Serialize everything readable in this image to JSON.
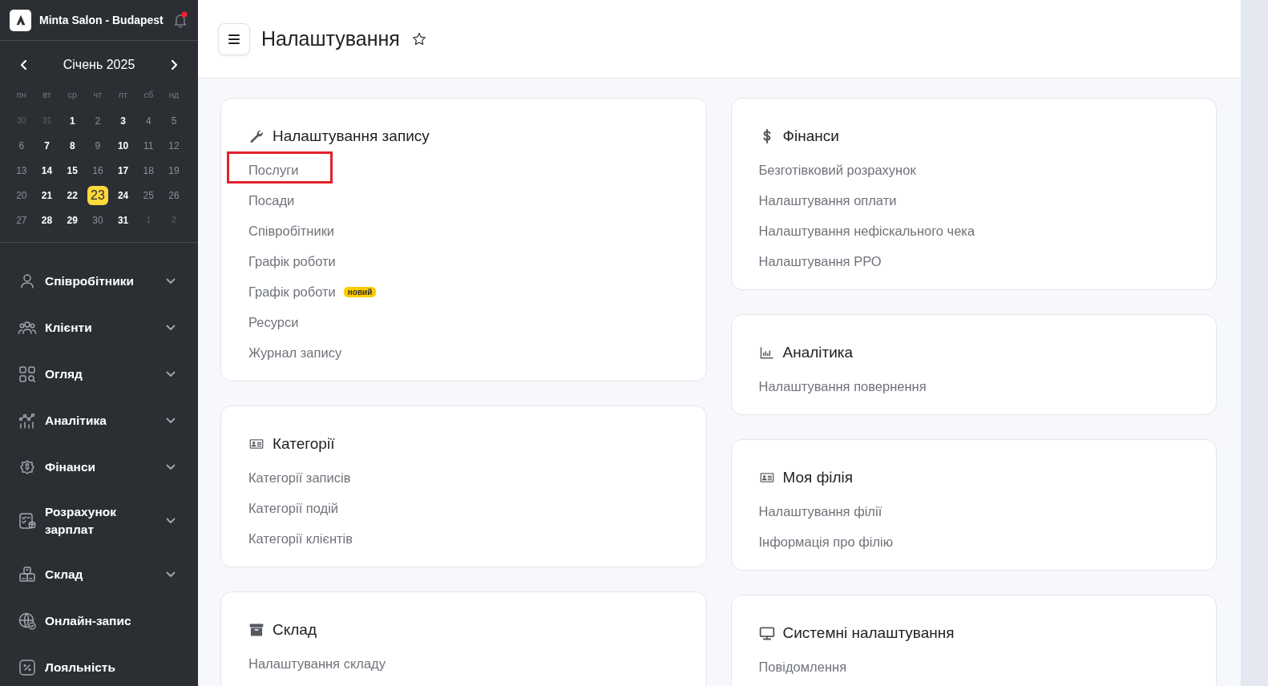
{
  "sidebar": {
    "salon_name": "Minta Salon - Budapest",
    "calendar": {
      "month": "Січень 2025",
      "weekdays": [
        "пн",
        "вт",
        "ср",
        "чт",
        "пт",
        "сб",
        "нд"
      ],
      "days": [
        {
          "label": "30",
          "kind": "outside",
          "selected": false
        },
        {
          "label": "31",
          "kind": "outside",
          "selected": false
        },
        {
          "label": "1",
          "kind": "busy",
          "selected": false
        },
        {
          "label": "2",
          "kind": "plain",
          "selected": false
        },
        {
          "label": "3",
          "kind": "busy",
          "selected": false
        },
        {
          "label": "4",
          "kind": "plain",
          "selected": false
        },
        {
          "label": "5",
          "kind": "plain",
          "selected": false
        },
        {
          "label": "6",
          "kind": "plain",
          "selected": false
        },
        {
          "label": "7",
          "kind": "busy",
          "selected": false
        },
        {
          "label": "8",
          "kind": "busy",
          "selected": false
        },
        {
          "label": "9",
          "kind": "plain",
          "selected": false
        },
        {
          "label": "10",
          "kind": "busy",
          "selected": false
        },
        {
          "label": "11",
          "kind": "plain",
          "selected": false
        },
        {
          "label": "12",
          "kind": "plain",
          "selected": false
        },
        {
          "label": "13",
          "kind": "plain",
          "selected": false
        },
        {
          "label": "14",
          "kind": "busy",
          "selected": false
        },
        {
          "label": "15",
          "kind": "busy",
          "selected": false
        },
        {
          "label": "16",
          "kind": "plain",
          "selected": false
        },
        {
          "label": "17",
          "kind": "busy",
          "selected": false
        },
        {
          "label": "18",
          "kind": "plain",
          "selected": false
        },
        {
          "label": "19",
          "kind": "plain",
          "selected": false
        },
        {
          "label": "20",
          "kind": "plain",
          "selected": false
        },
        {
          "label": "21",
          "kind": "busy",
          "selected": false
        },
        {
          "label": "22",
          "kind": "busy",
          "selected": false
        },
        {
          "label": "23",
          "kind": "busy",
          "selected": true
        },
        {
          "label": "24",
          "kind": "busy",
          "selected": false
        },
        {
          "label": "25",
          "kind": "plain",
          "selected": false
        },
        {
          "label": "26",
          "kind": "plain",
          "selected": false
        },
        {
          "label": "27",
          "kind": "plain",
          "selected": false
        },
        {
          "label": "28",
          "kind": "busy",
          "selected": false
        },
        {
          "label": "29",
          "kind": "busy",
          "selected": false
        },
        {
          "label": "30",
          "kind": "plain",
          "selected": false
        },
        {
          "label": "31",
          "kind": "busy",
          "selected": false
        },
        {
          "label": "1",
          "kind": "outside",
          "selected": false
        },
        {
          "label": "2",
          "kind": "outside",
          "selected": false
        }
      ]
    },
    "items": [
      {
        "label": "Співробітники",
        "expandable": true
      },
      {
        "label": "Клієнти",
        "expandable": true
      },
      {
        "label": "Огляд",
        "expandable": true
      },
      {
        "label": "Аналітика",
        "expandable": true
      },
      {
        "label": "Фінанси",
        "expandable": true
      },
      {
        "label": "Розрахунок зарплат",
        "expandable": true
      },
      {
        "label": "Склад",
        "expandable": true
      },
      {
        "label": "Онлайн-запис",
        "expandable": false
      },
      {
        "label": "Лояльність",
        "expandable": false
      }
    ]
  },
  "page": {
    "title": "Налаштування"
  },
  "columns": [
    [
      {
        "title": "Налаштування запису",
        "links": [
          {
            "label": "Послуги",
            "highlighted": true
          },
          {
            "label": "Посади",
            "highlighted": false
          },
          {
            "label": "Співробітники",
            "highlighted": false
          },
          {
            "label": "Графік роботи",
            "highlighted": false
          },
          {
            "label": "Графік роботи",
            "badge": "новий",
            "highlighted": false
          },
          {
            "label": "Ресурси",
            "highlighted": false
          },
          {
            "label": "Журнал запису",
            "highlighted": false
          }
        ]
      },
      {
        "title": "Категорії",
        "links": [
          {
            "label": "Категорії записів",
            "highlighted": false
          },
          {
            "label": "Категорії подій",
            "highlighted": false
          },
          {
            "label": "Категорії клієнтів",
            "highlighted": false
          }
        ]
      },
      {
        "title": "Склад",
        "links": [
          {
            "label": "Налаштування складу",
            "highlighted": false
          }
        ]
      }
    ],
    [
      {
        "title": "Фінанси",
        "links": [
          {
            "label": "Безготівковий розрахунок",
            "highlighted": false
          },
          {
            "label": "Налаштування оплати",
            "highlighted": false
          },
          {
            "label": "Налаштування нефіскального чека",
            "highlighted": false
          },
          {
            "label": "Налаштування РРО",
            "highlighted": false
          }
        ]
      },
      {
        "title": "Аналітика",
        "links": [
          {
            "label": "Налаштування повернення",
            "highlighted": false
          }
        ]
      },
      {
        "title": "Моя філія",
        "links": [
          {
            "label": "Налаштування філії",
            "highlighted": false
          },
          {
            "label": "Інформація про філію",
            "highlighted": false
          }
        ]
      },
      {
        "title": "Системні налаштування",
        "links": [
          {
            "label": "Повідомлення",
            "highlighted": false
          }
        ]
      }
    ]
  ]
}
